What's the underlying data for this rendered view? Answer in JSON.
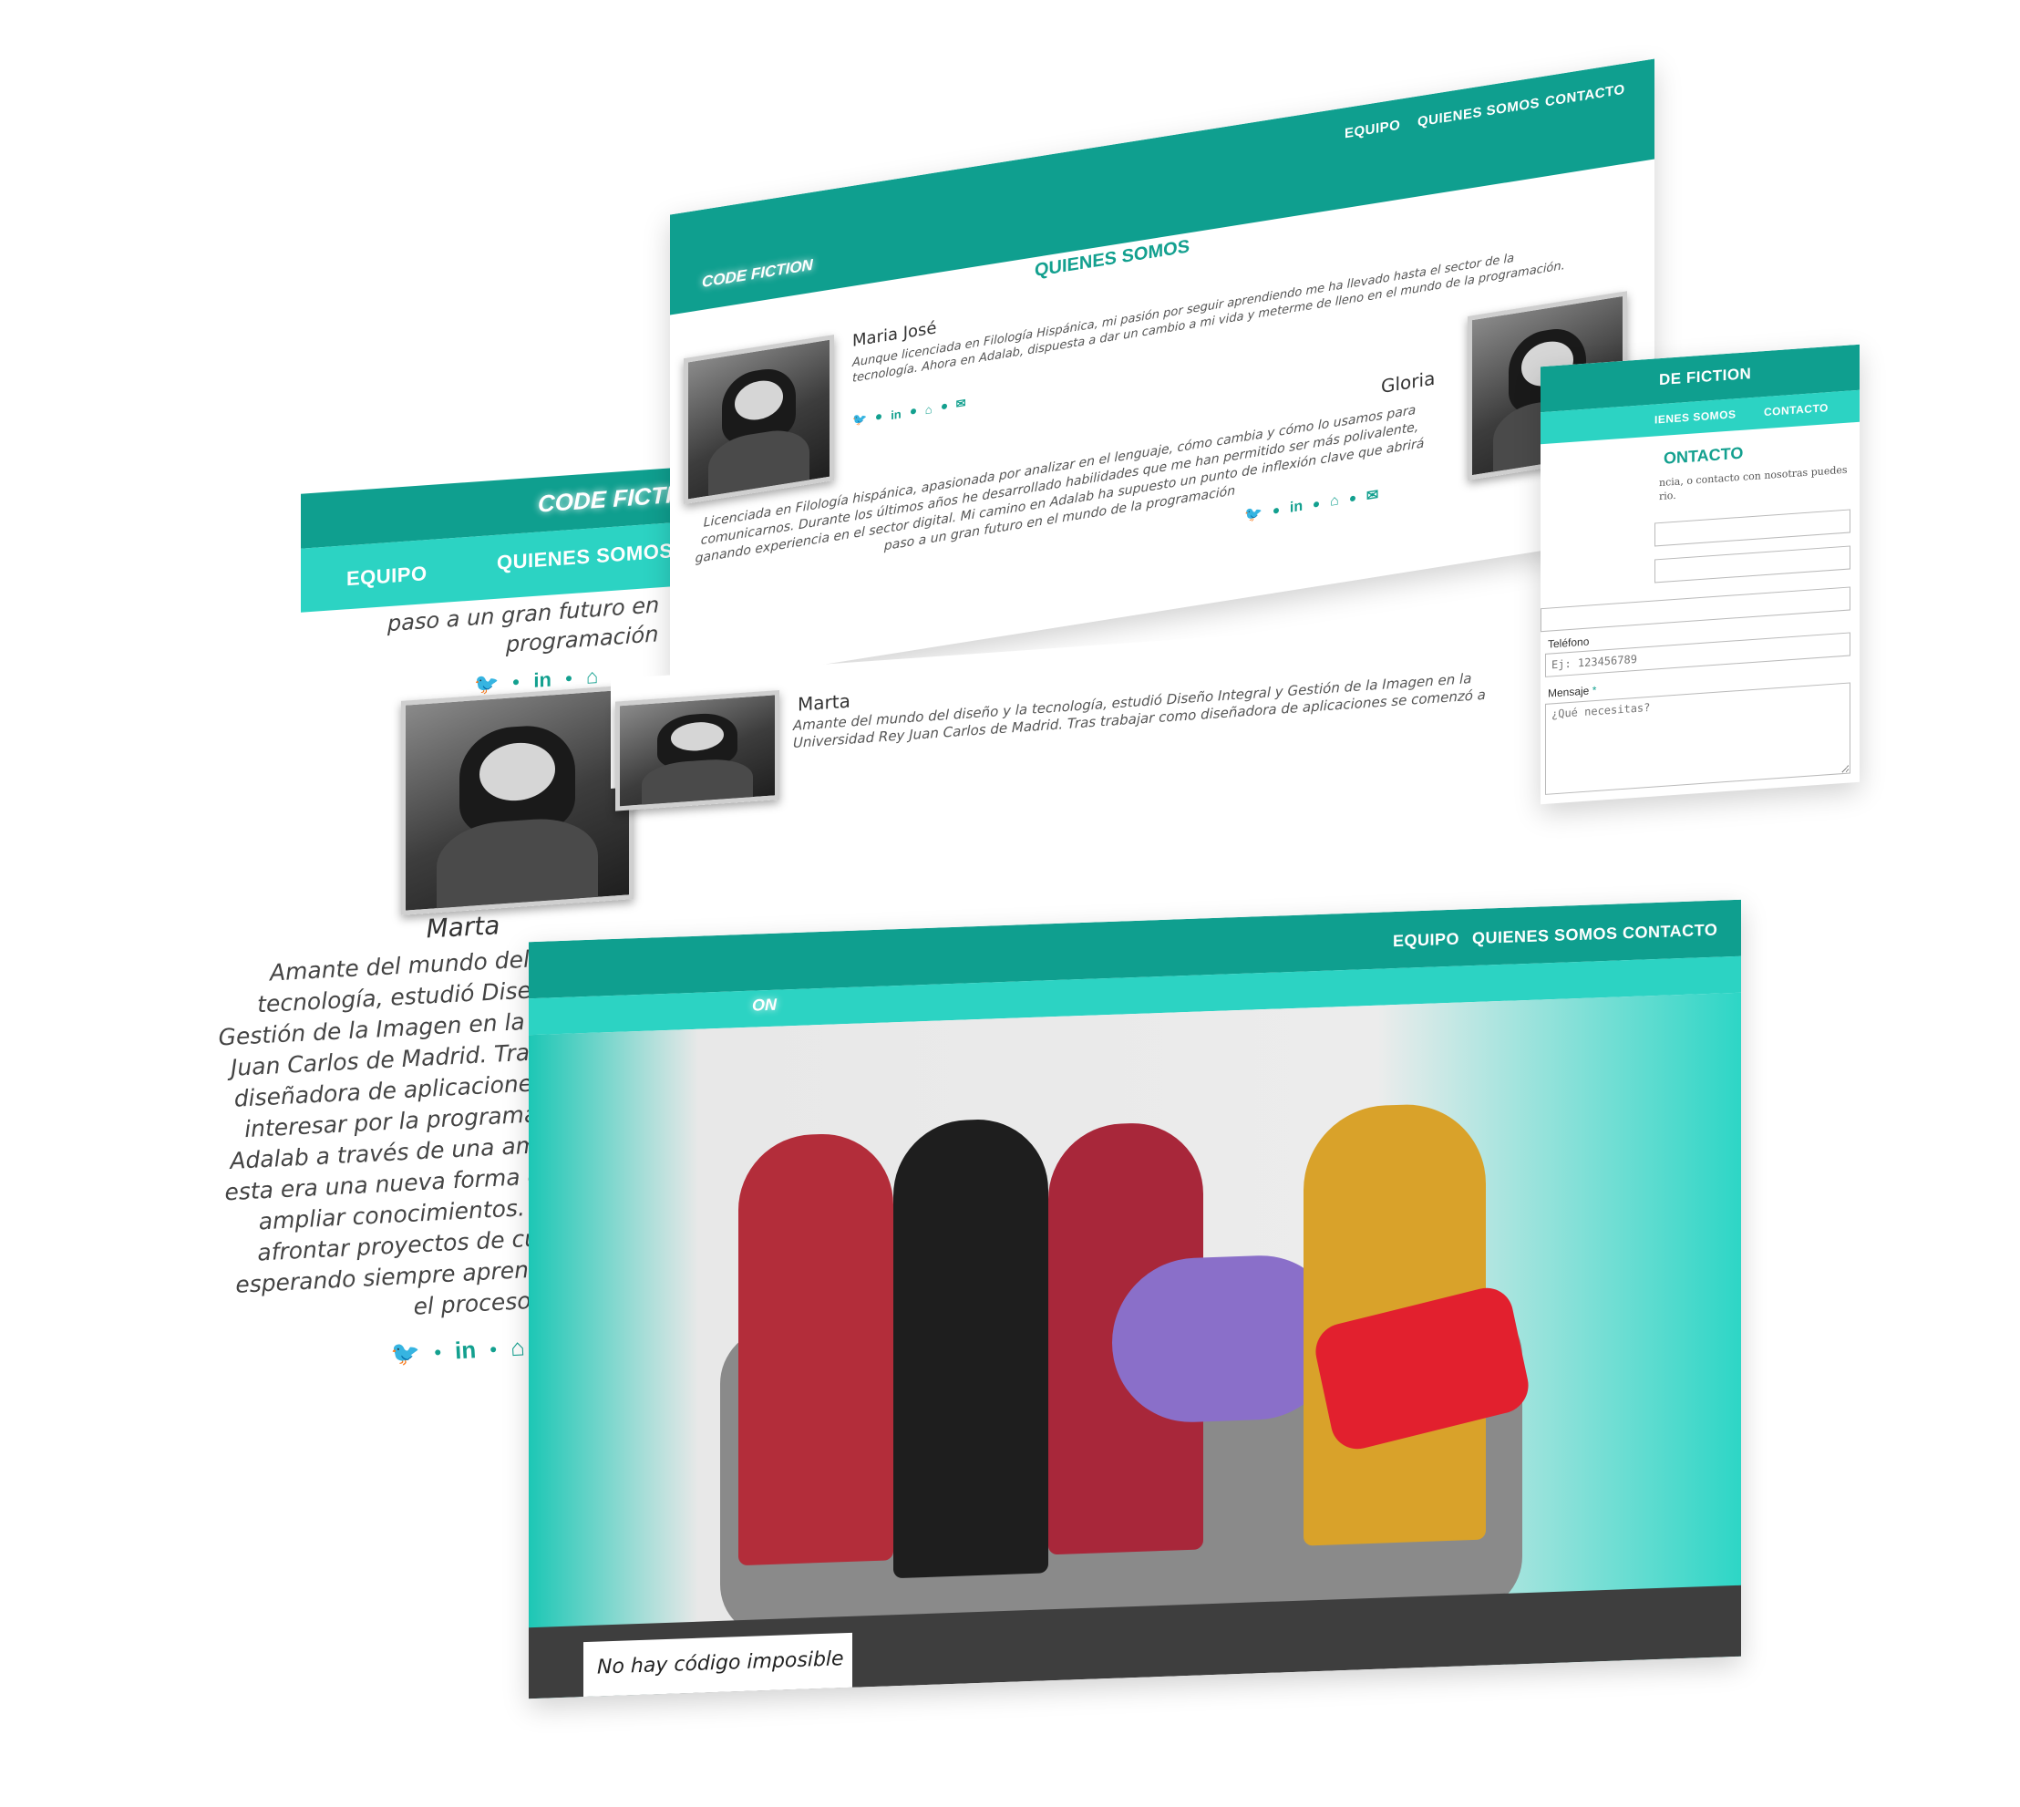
{
  "brand": "CODE FICTION",
  "nav": {
    "equipo": "EQUIPO",
    "quienes": "QUIENES SOMOS",
    "contacto": "CONTACTO"
  },
  "about_page": {
    "title": "QUIENES SOMOS",
    "members": [
      {
        "name": "Maria José",
        "bio": "Aunque licenciada en Filología Hispánica, mi pasión por seguir aprendiendo me ha llevado hasta el sector de la tecnología. Ahora en Adalab, dispuesta a dar un cambio a mi vida y meterme de lleno en el mundo de la programación."
      },
      {
        "name": "Gloria",
        "bio": "Licenciada en Filología hispánica, apasionada por analizar en el lenguaje, cómo cambia y cómo lo usamos para comunicarnos. Durante los últimos años he desarrollado habilidades que me han permitido ser más polivalente, ganando experiencia en el sector digital. Mi camino en Adalab ha supuesto un punto de inflexión clave que abrirá paso a un gran futuro en el mundo de la programación"
      },
      {
        "name": "Marta",
        "bio": "Amante del mundo del diseño y la tecnología, estudió Diseño Integral y Gestión de la Imagen en la Universidad Rey Juan Carlos de Madrid. Tras trabajar como diseñadora de aplicaciones se comenzó a"
      }
    ]
  },
  "mobile_page": {
    "partial_top": "paso a un gran futuro en",
    "partial_top2": "programación",
    "member": {
      "name": "Marta",
      "bio": "Amante del mundo del diseño y la tecnología, estudió Diseño Integral y Gestión de la Imagen en la Universidad Rey Juan Carlos de Madrid. Tras trabajar como diseñadora de aplicaciones se comenzó a interesar por la programación. Encontró Adalab a través de una amiga y pensó que esta era una nueva forma de reinventarse y ampliar conocimientos. ¡Con ganas de afrontar proyectos de cualquier índole, esperando siempre aprender y disfrutar en el procesos!"
    }
  },
  "contact_page": {
    "brand_partial": "DE FICTION",
    "nav_partial": "IENES SOMOS",
    "title_partial": "ONTACTO",
    "intro_partial": "ncia, o contacto con nosotras puedes",
    "intro_partial2": "rio.",
    "phone_label": "Teléfono",
    "phone_placeholder": "Ej: 123456789",
    "message_label": "Mensaje",
    "required_mark": "*",
    "message_placeholder": "¿Qué necesitas?"
  },
  "home_page": {
    "brand_partial": "ON",
    "tagline": "No hay código imposible"
  },
  "social_icons": [
    "twitter-icon",
    "linkedin-icon",
    "github-icon",
    "mail-icon"
  ],
  "colors": {
    "teal": "#0f9f8f",
    "teal_light": "#2cd3c3",
    "accent_text": "#13a08f"
  }
}
